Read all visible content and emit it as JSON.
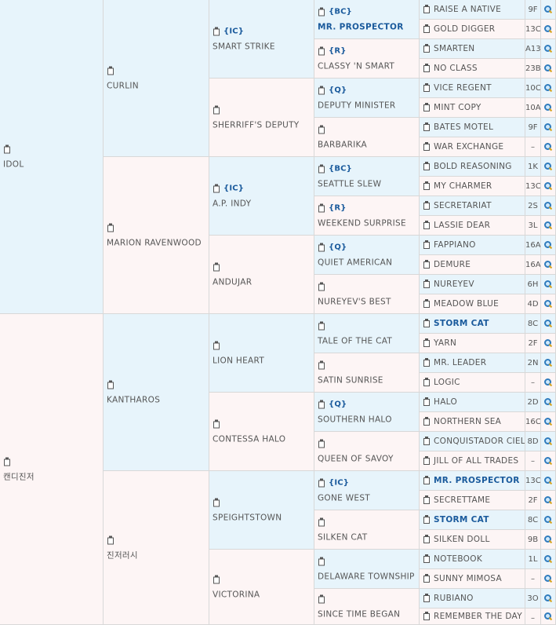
{
  "tree": {
    "name": "",
    "children": [
      {
        "name": "IDOL",
        "children": [
          {
            "name": "CURLIN",
            "children": [
              {
                "name": "SMART STRIKE",
                "tag": "{IC}",
                "children": [
                  {
                    "name": "MR. PROSPECTOR",
                    "tag": "{BC}",
                    "strong": true,
                    "children": [
                      {
                        "name": "RAISE A NATIVE",
                        "code": "9F"
                      },
                      {
                        "name": "GOLD DIGGER",
                        "code": "13C"
                      }
                    ]
                  },
                  {
                    "name": "CLASSY 'N SMART",
                    "tag": "{R}",
                    "children": [
                      {
                        "name": "SMARTEN",
                        "code": "A13"
                      },
                      {
                        "name": "NO CLASS",
                        "code": "23B"
                      }
                    ]
                  }
                ]
              },
              {
                "name": "SHERRIFF'S DEPUTY",
                "children": [
                  {
                    "name": "DEPUTY MINISTER",
                    "tag": "{Q}",
                    "children": [
                      {
                        "name": "VICE REGENT",
                        "code": "10C"
                      },
                      {
                        "name": "MINT COPY",
                        "code": "10A"
                      }
                    ]
                  },
                  {
                    "name": "BARBARIKA",
                    "children": [
                      {
                        "name": "BATES MOTEL",
                        "code": "9F"
                      },
                      {
                        "name": "WAR EXCHANGE",
                        "code": "–"
                      }
                    ]
                  }
                ]
              }
            ]
          },
          {
            "name": "MARION RAVENWOOD",
            "children": [
              {
                "name": "A.P. INDY",
                "tag": "{IC}",
                "children": [
                  {
                    "name": "SEATTLE SLEW",
                    "tag": "{BC}",
                    "children": [
                      {
                        "name": "BOLD REASONING",
                        "code": "1K"
                      },
                      {
                        "name": "MY CHARMER",
                        "code": "13C"
                      }
                    ]
                  },
                  {
                    "name": "WEEKEND SURPRISE",
                    "tag": "{R}",
                    "children": [
                      {
                        "name": "SECRETARIAT",
                        "code": "2S"
                      },
                      {
                        "name": "LASSIE DEAR",
                        "code": "3L"
                      }
                    ]
                  }
                ]
              },
              {
                "name": "ANDUJAR",
                "children": [
                  {
                    "name": "QUIET AMERICAN",
                    "tag": "{Q}",
                    "children": [
                      {
                        "name": "FAPPIANO",
                        "code": "16A"
                      },
                      {
                        "name": "DEMURE",
                        "code": "16A"
                      }
                    ]
                  },
                  {
                    "name": "NUREYEV'S BEST",
                    "children": [
                      {
                        "name": "NUREYEV",
                        "code": "6H"
                      },
                      {
                        "name": "MEADOW BLUE",
                        "code": "4D"
                      }
                    ]
                  }
                ]
              }
            ]
          }
        ]
      },
      {
        "name": "캔디진저",
        "children": [
          {
            "name": "KANTHAROS",
            "children": [
              {
                "name": "LION HEART",
                "children": [
                  {
                    "name": "TALE OF THE CAT",
                    "children": [
                      {
                        "name": "STORM CAT",
                        "code": "8C",
                        "strong": true
                      },
                      {
                        "name": "YARN",
                        "code": "2F"
                      }
                    ]
                  },
                  {
                    "name": "SATIN SUNRISE",
                    "children": [
                      {
                        "name": "MR. LEADER",
                        "code": "2N"
                      },
                      {
                        "name": "LOGIC",
                        "code": "–"
                      }
                    ]
                  }
                ]
              },
              {
                "name": "CONTESSA HALO",
                "children": [
                  {
                    "name": "SOUTHERN HALO",
                    "tag": "{Q}",
                    "children": [
                      {
                        "name": "HALO",
                        "code": "2D"
                      },
                      {
                        "name": "NORTHERN SEA",
                        "code": "16C"
                      }
                    ]
                  },
                  {
                    "name": "QUEEN OF SAVOY",
                    "children": [
                      {
                        "name": "CONQUISTADOR CIELO",
                        "code": "8D"
                      },
                      {
                        "name": "JILL OF ALL TRADES",
                        "code": "–"
                      }
                    ]
                  }
                ]
              }
            ]
          },
          {
            "name": "진저러시",
            "children": [
              {
                "name": "SPEIGHTSTOWN",
                "children": [
                  {
                    "name": "GONE WEST",
                    "tag": "{IC}",
                    "children": [
                      {
                        "name": "MR. PROSPECTOR",
                        "code": "13C",
                        "strong": true
                      },
                      {
                        "name": "SECRETTAME",
                        "code": "2F"
                      }
                    ]
                  },
                  {
                    "name": "SILKEN CAT",
                    "children": [
                      {
                        "name": "STORM CAT",
                        "code": "8C",
                        "strong": true
                      },
                      {
                        "name": "SILKEN DOLL",
                        "code": "9B"
                      }
                    ]
                  }
                ]
              },
              {
                "name": "VICTORINA",
                "children": [
                  {
                    "name": "DELAWARE TOWNSHIP",
                    "children": [
                      {
                        "name": "NOTEBOOK",
                        "code": "1L"
                      },
                      {
                        "name": "SUNNY MIMOSA",
                        "code": "–"
                      }
                    ]
                  },
                  {
                    "name": "SINCE TIME BEGAN",
                    "children": [
                      {
                        "name": "RUBIANO",
                        "code": "3O"
                      },
                      {
                        "name": "REMEMBER THE DAY",
                        "code": "–"
                      }
                    ]
                  }
                ]
              }
            ]
          }
        ]
      }
    ]
  }
}
